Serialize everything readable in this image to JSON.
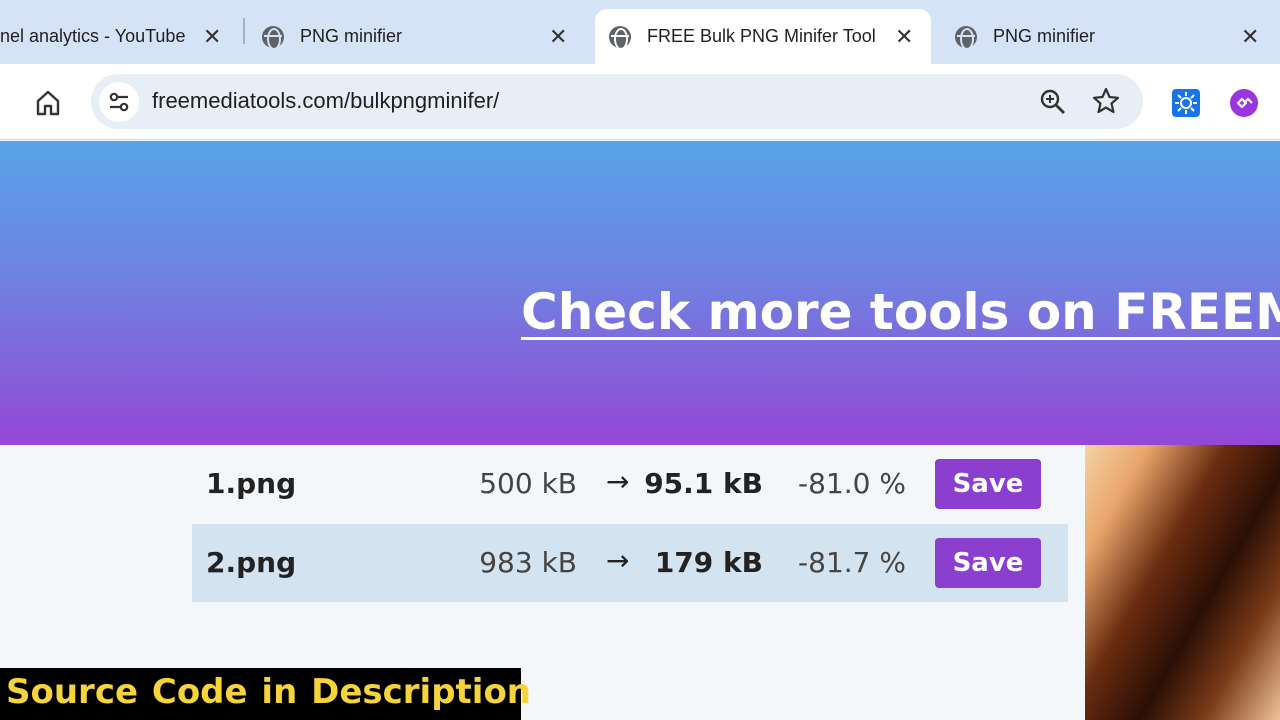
{
  "tabs": [
    {
      "title": "nel analytics - YouTube",
      "active": false
    },
    {
      "title": "PNG minifier",
      "active": false
    },
    {
      "title": "FREE Bulk PNG Minifer Tool",
      "active": true
    },
    {
      "title": "PNG minifier",
      "active": false
    }
  ],
  "tab_close_glyph": "✕",
  "address_bar": {
    "url": "freemediatools.com/bulkpngminifer/"
  },
  "banner": {
    "link_text": "Check more tools on FREEMEDIATOOLS"
  },
  "results": {
    "arrow": "→",
    "save_label": "Save",
    "rows": [
      {
        "file": "1.png",
        "original": "500 kB",
        "minified": "95.1 kB",
        "change": "-81.0 %"
      },
      {
        "file": "2.png",
        "original": "983 kB",
        "minified": "179 kB",
        "change": "-81.7 %"
      }
    ]
  },
  "caption": {
    "text": "Source Code in  Description"
  },
  "colors": {
    "accent": "#8a3fcf",
    "banner_top": "#58a3e8",
    "banner_bottom": "#9447d6",
    "caption_text": "#f5d33a"
  },
  "icons": [
    "globe-icon",
    "close-icon",
    "home-icon",
    "site-info-icon",
    "zoom-icon",
    "star-icon",
    "extension-icon"
  ]
}
